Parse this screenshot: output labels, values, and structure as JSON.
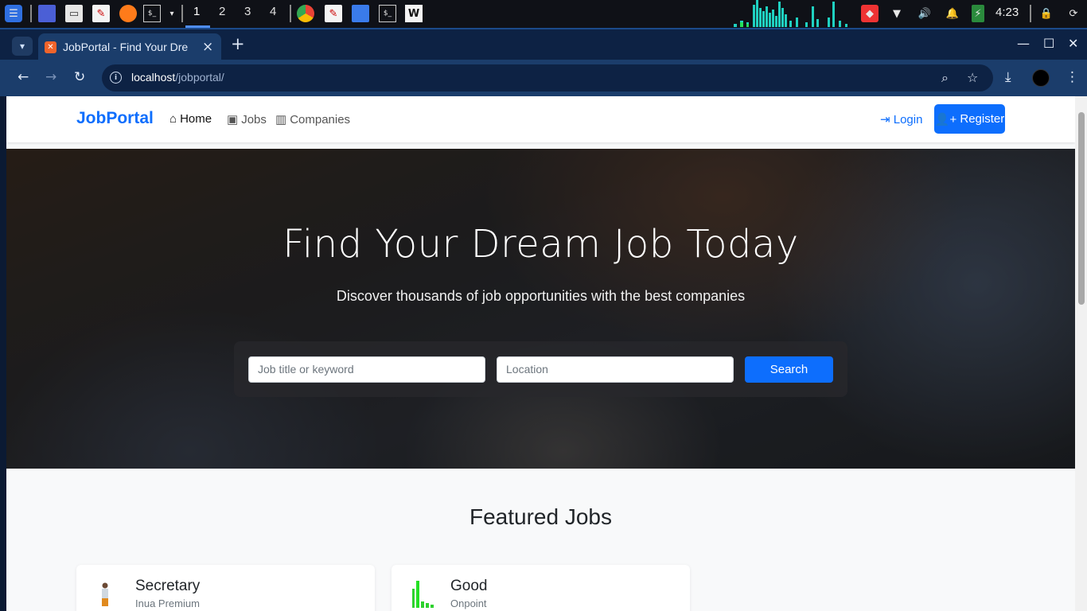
{
  "taskbar": {
    "workspaces": [
      "1",
      "2",
      "3",
      "4"
    ],
    "active_workspace": "1",
    "clock": "4:23"
  },
  "browser": {
    "tab_title": "JobPortal - Find Your Dre",
    "url_host": "localhost",
    "url_path": "/jobportal/"
  },
  "site": {
    "brand": "JobPortal",
    "nav": [
      {
        "label": "Home",
        "icon": "home-icon"
      },
      {
        "label": "Jobs",
        "icon": "briefcase-icon"
      },
      {
        "label": "Companies",
        "icon": "building-icon"
      }
    ],
    "login_label": "Login",
    "register_label": "Register"
  },
  "hero": {
    "title": "Find Your Dream Job Today",
    "subtitle": "Discover thousands of job opportunities with the best companies",
    "keyword_placeholder": "Job title or keyword",
    "location_placeholder": "Location",
    "search_label": "Search"
  },
  "featured": {
    "title": "Featured Jobs",
    "jobs": [
      {
        "title": "Secretary",
        "company": "Inua Premium"
      },
      {
        "title": "Good",
        "company": "Onpoint"
      }
    ]
  },
  "colors": {
    "primary": "#0d6efd",
    "browser_frame": "#1b3d6b",
    "taskbar": "#0f1117"
  }
}
